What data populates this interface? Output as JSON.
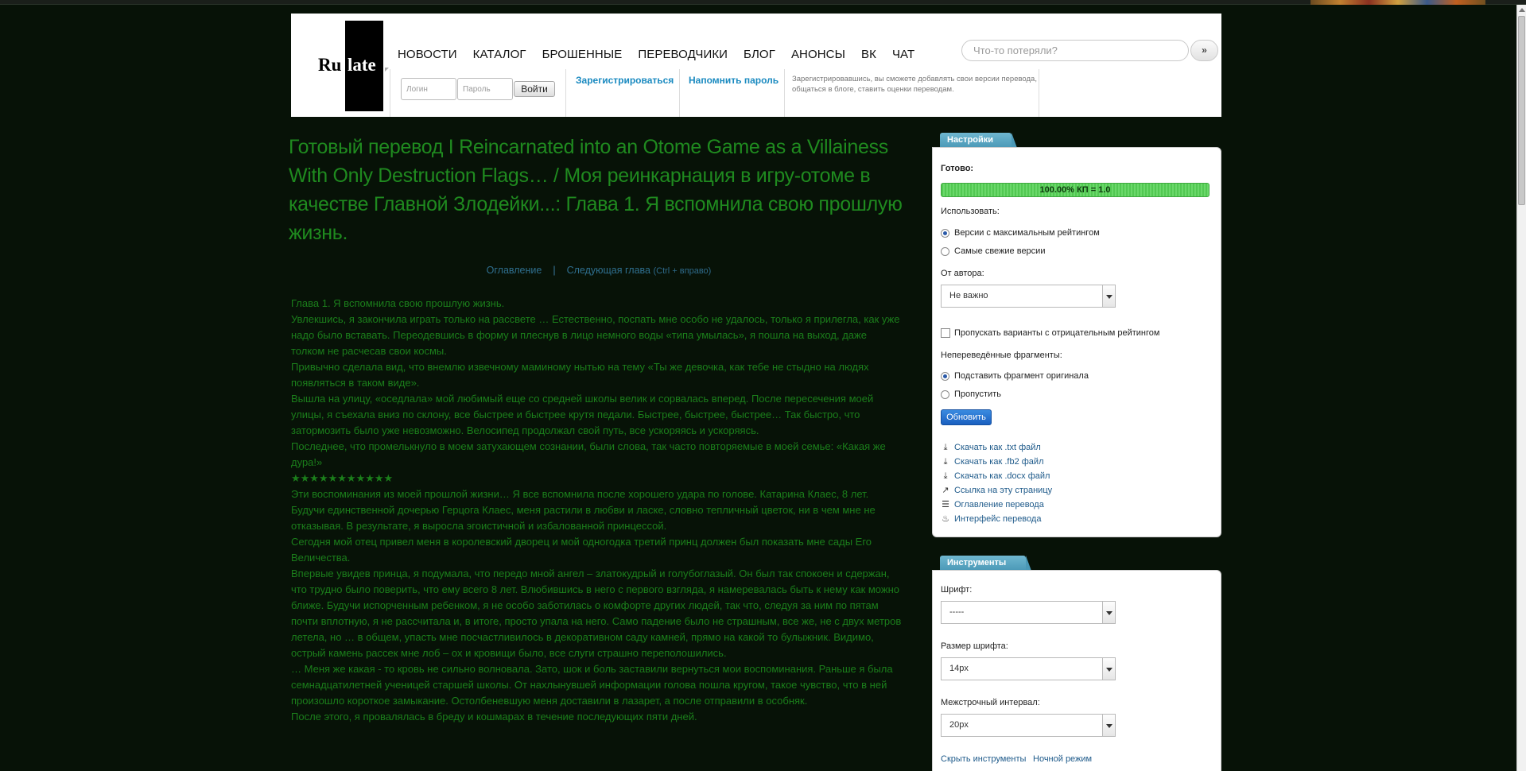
{
  "logo": {
    "ru": "Ru",
    "late": "late"
  },
  "nav": [
    "НОВОСТИ",
    "КАТАЛОГ",
    "БРОШЕННЫЕ",
    "ПЕРЕВОДЧИКИ",
    "БЛОГ",
    "АНОНСЫ",
    "ВК",
    "ЧАТ"
  ],
  "search": {
    "placeholder": "Что-то потеряли?",
    "button": "»"
  },
  "auth": {
    "login_placeholder": "Логин",
    "password_placeholder": "Пароль",
    "login_button": "Войти",
    "register": "Зарегистрироваться",
    "remind": "Напомнить пароль",
    "hint": "Зарегистрировавшись, вы сможете добавлять свои версии перевода, общаться в блоге, ставить оценки переводам."
  },
  "page": {
    "title": "Готовый перевод I Reincarnated into an Otome Game as a Villainess With Only Destruction Flags… / Моя реинкарнация в игру-отоме в качестве Главной Злодейки...: Глава 1. Я вспомнила свою прошлую жизнь.",
    "toc_link": "Оглавление",
    "separator": "|",
    "next_link": "Следующая глава",
    "next_hint": "(Ctrl + вправо)"
  },
  "paragraphs": [
    "Глава 1. Я вспомнила свою прошлую жизнь.",
    "Увлекшись, я закончила играть только на рассвете … Естественно, поспать мне особо не удалось, только я прилегла, как уже надо было вставать. Переодевшись в форму и плеснув в лицо немного воды «типа умылась», я пошла на выход, даже толком не расчесав свои космы.",
    "Привычно сделала вид, что внемлю извечному маминому нытью на тему «Ты же девочка, как тебе не стыдно на людях появляться в таком виде».",
    "Вышла на улицу, «оседлала» мой любимый еще со средней школы велик и сорвалась вперед. После пересечения моей улицы, я съехала вниз по склону, все быстрее и быстрее крутя педали. Быстрее, быстрее, быстрее… Так быстро, что затормозить было уже невозможно. Велосипед продолжал свой путь, все ускоряясь и ускоряясь.",
    "Последнее, что промелькнуло в моем затухающем сознании, были слова, так часто повторяемые в моей семье: «Какая же дура!»",
    "★★★★★★★★★★★",
    "Эти воспоминания из моей прошлой жизни… Я все вспомнила после хорошего удара по голове. Катарина Клаес, 8 лет. Будучи единственной дочерью Герцога Клаес, меня растили в любви и ласке, словно тепличный цветок, ни в чем мне не отказывая. В результате, я выросла эгоистичной и избалованной принцессой.",
    "Сегодня мой отец привел меня в королевский дворец и мой одногодка третий принц должен был показать мне сады Его Величества.",
    "Впервые увидев принца, я подумала, что передо мной ангел – златокудрый и голубоглазый. Он был так спокоен и сдержан, что трудно было поверить, что ему всего 8 лет. Влюбившись в него с первого взгляда, я намеревалась быть к нему как можно ближе. Будучи испорченным ребенком, я не особо заботилась о комфорте других людей, так что, следуя за ним по пятам почти вплотную, я не рассчитала и, в итоге, просто упала на него. Само падение было не страшным, все же, не с двух метров летела, но … в общем, упасть мне посчастливилось в декоративном саду камней, прямо на какой то булыжник. Видимо, острый камень рассек мне лоб – ох и кровищи было, все слуги страшно переполошились.",
    "… Меня же какая - то кровь не сильно волновала. Зато, шок и боль заставили вернуться мои воспоминания. Раньше я была семнадцатилетней ученицей старшей школы. От нахлынувшей информации голова пошла кругом, такое чувство, что в ней произошло короткое замыкание. Остолбеневшую меня доставили в лазарет, а после отправили в особняк.",
    "После этого, я провалялась в бреду и кошмарах в течение последующих пяти дней."
  ],
  "settings": {
    "tab": "Настройки",
    "ready_label": "Готово:",
    "progress_text": "100.00% КП = 1.0",
    "progress_fraction": 1.0,
    "use_label": "Использовать:",
    "use_options": [
      "Версии с максимальным рейтингом",
      "Самые свежие версии"
    ],
    "author_label": "От автора:",
    "author_value": "Не важно",
    "skip_negative": "Пропускать варианты с отрицательным рейтингом",
    "untranslated_label": "Непереведённые фрагменты:",
    "untranslated_options": [
      "Подставить фрагмент оригинала",
      "Пропустить"
    ],
    "update_button": "Обновить",
    "links": [
      {
        "icon": "download-icon",
        "label": "Скачать как .txt файл"
      },
      {
        "icon": "download-icon",
        "label": "Скачать как .fb2 файл"
      },
      {
        "icon": "download-icon",
        "label": "Скачать как .docx файл"
      },
      {
        "icon": "share-link-icon",
        "label": "Ссылка на эту страницу"
      },
      {
        "icon": "list-icon",
        "label": "Оглавление перевода"
      },
      {
        "icon": "flame-icon",
        "label": "Интерфейс перевода"
      }
    ]
  },
  "tools": {
    "tab": "Инструменты",
    "font_label": "Шрифт:",
    "font_value": "-----",
    "size_label": "Размер шрифта:",
    "size_value": "14px",
    "spacing_label": "Межстрочный интервал:",
    "spacing_value": "20px",
    "hide_link": "Скрыть инструменты",
    "night_link": "Ночной режим"
  },
  "colors": {
    "background": "#071207",
    "text_green": "#1b7e1b",
    "title_green": "#1f8a1f",
    "link_blue": "#1a8ac0",
    "progress_green": "#52c852",
    "tab_blue": "#4a98b6"
  }
}
